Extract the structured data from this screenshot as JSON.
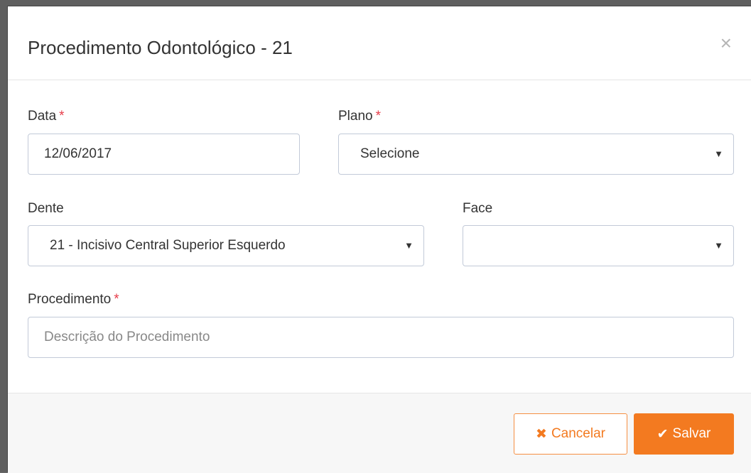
{
  "modal": {
    "title": "Procedimento Odontológico - 21",
    "close_glyph": "×"
  },
  "form": {
    "data": {
      "label": "Data",
      "required_mark": "*",
      "value": "12/06/2017"
    },
    "plano": {
      "label": "Plano",
      "required_mark": "*",
      "value": "Selecione"
    },
    "dente": {
      "label": "Dente",
      "value": "21 - Incisivo Central Superior Esquerdo"
    },
    "face": {
      "label": "Face",
      "value": ""
    },
    "procedimento": {
      "label": "Procedimento",
      "required_mark": "*",
      "placeholder": "Descrição do Procedimento"
    }
  },
  "footer": {
    "cancel_icon": "✖",
    "cancel_label": "Cancelar",
    "save_icon": "✔",
    "save_label": "Salvar"
  },
  "icons": {
    "caret": "▼"
  },
  "colors": {
    "accent": "#f37a20",
    "required": "#e73d4a",
    "border": "#c2cad8"
  }
}
